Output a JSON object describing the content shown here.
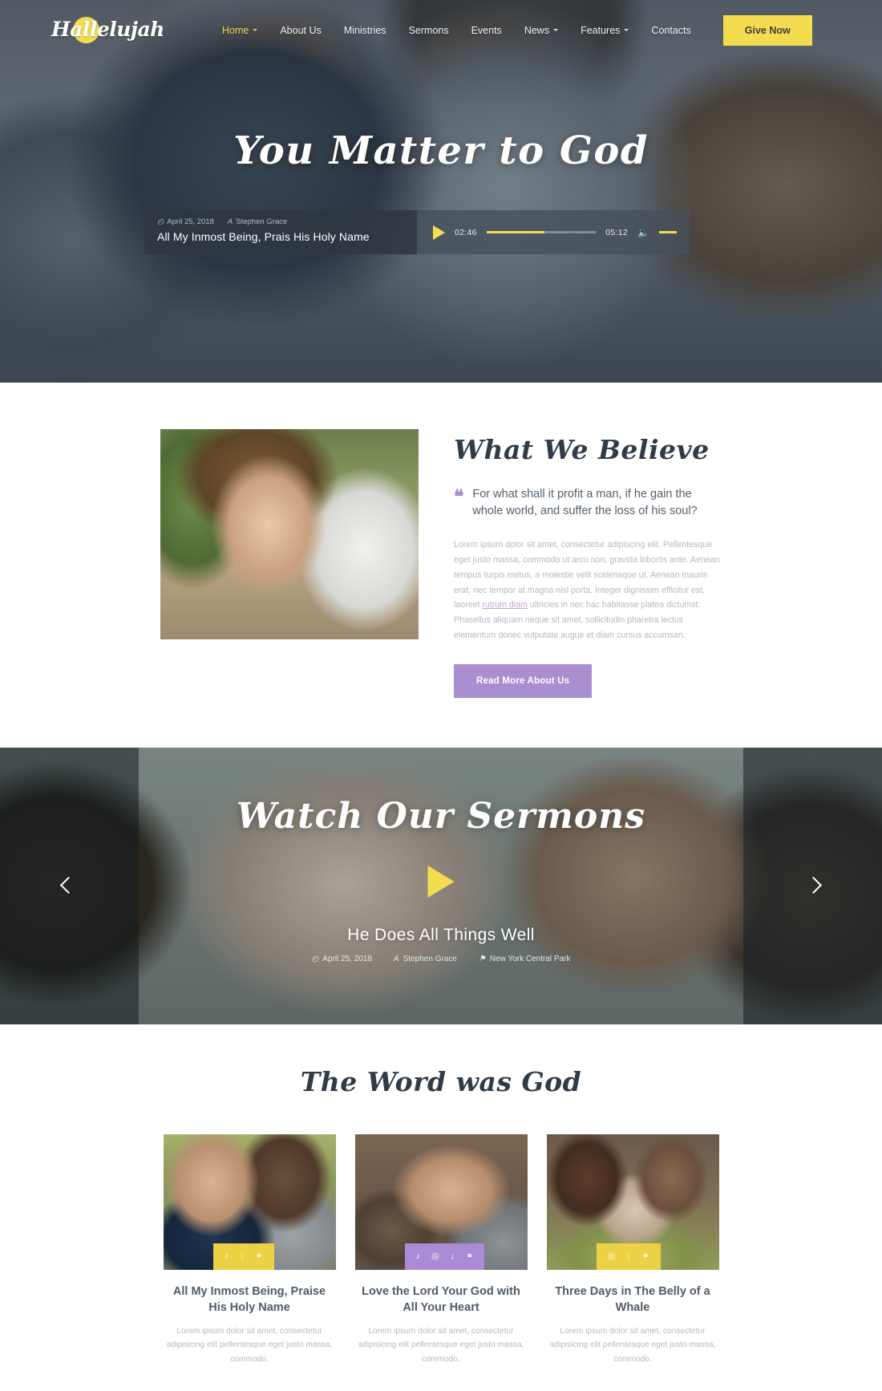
{
  "header": {
    "logo_text": "Hallelujah",
    "nav": [
      {
        "label": "Home",
        "active": true,
        "caret": true
      },
      {
        "label": "About Us",
        "active": false,
        "caret": false
      },
      {
        "label": "Ministries",
        "active": false,
        "caret": false
      },
      {
        "label": "Sermons",
        "active": false,
        "caret": false
      },
      {
        "label": "Events",
        "active": false,
        "caret": false
      },
      {
        "label": "News",
        "active": false,
        "caret": true
      },
      {
        "label": "Features",
        "active": false,
        "caret": true
      },
      {
        "label": "Contacts",
        "active": false,
        "caret": false
      }
    ],
    "cta_label": "Give Now"
  },
  "hero": {
    "title": "You Matter to God",
    "player": {
      "date": "April 25, 2018",
      "author": "Stephen Grace",
      "track_title": "All My Inmost Being, Prais His Holy Name",
      "current_time": "02:46",
      "duration": "05:12",
      "progress_percent": 53,
      "play_icon": "play-icon",
      "volume_icon": "volume-icon"
    }
  },
  "believe": {
    "heading": "What We Believe",
    "quote": "For what shall it profit a man, if he gain the whole world, and suffer the loss of his soul?",
    "paragraph_before": "Lorem ipsum dolor sit amet, consectetur adipiscing elit. Pellentesque eget justo massa, commodo ut arcu non, gravida lobortis ante. Aenean tempus turpis metus, a molestie velit scelerisque ut. Aenean mauris erat, nec tempor at magna nisl porta. Integer dignissim efficitur est, laoreet ",
    "paragraph_link": "rutrum diam",
    "paragraph_after": " ultricies in nec hac habitasse platea dictumst. Phasellus aliquam neque sit amet, sollicitudin pharetra lectus elementum donec vulputate augue et diam cursus accumsan.",
    "button_label": "Read More About Us",
    "accent_color": "#a98fd0"
  },
  "sermons": {
    "heading": "Watch Our Sermons",
    "sermon_title": "He Does All Things Well",
    "date": "April 25, 2018",
    "author": "Stephen Grace",
    "location": "New York Central Park",
    "play_icon": "play-icon",
    "prev_icon": "chevron-left-icon",
    "next_icon": "chevron-right-icon",
    "accent_color": "#f4dc50"
  },
  "blog": {
    "heading": "The Word was God",
    "cards": [
      {
        "title": "All My Inmost Being, Praise His Holy Name",
        "excerpt": "Lorem ipsum dolor sit amet, consectetur adipisicing elit pellentesque eget justo massa, commodo.",
        "badge_color": "#ecd144",
        "badge_style": "yellow",
        "icons": [
          "headphones-icon",
          "download-icon",
          "link-icon"
        ],
        "thumb_class": "t1"
      },
      {
        "title": "Love the Lord Your God with All Your Heart",
        "excerpt": "Lorem ipsum dolor sit amet, consectetur adipisicing elit pellentesque eget justo massa, commodo.",
        "badge_color": "#ab8ad6",
        "badge_style": "purple",
        "icons": [
          "headphones-icon",
          "play-circle-icon",
          "download-icon",
          "link-icon"
        ],
        "thumb_class": "t2"
      },
      {
        "title": "Three Days in The Belly of a Whale",
        "excerpt": "Lorem ipsum dolor sit amet, consectetur adipisicing elit pellentesque eget justo massa, commodo.",
        "badge_color": "#ecd144",
        "badge_style": "yellow",
        "icons": [
          "play-circle-icon",
          "download-icon",
          "link-icon"
        ],
        "thumb_class": "t3"
      }
    ]
  },
  "icons": {
    "clock": "◴",
    "user": "A",
    "pin": "⚑",
    "headphones": "♪",
    "play_circle": "◎",
    "download": "↓",
    "link": "⚭",
    "volume": "◂"
  }
}
